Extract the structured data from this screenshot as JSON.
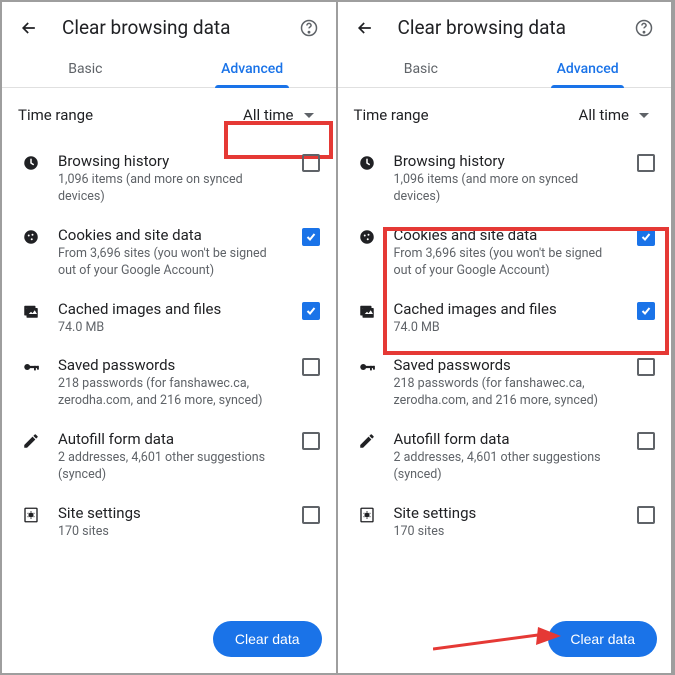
{
  "pageTitle": "Clear browsing data",
  "tabs": {
    "basic": "Basic",
    "advanced": "Advanced"
  },
  "timeRange": {
    "label": "Time range",
    "value": "All time"
  },
  "items": {
    "history": {
      "title": "Browsing history",
      "sub": "1,096 items (and more on synced devices)"
    },
    "cookies": {
      "title": "Cookies and site data",
      "sub": "From 3,696 sites (you won't be signed out of your Google Account)"
    },
    "cache": {
      "title": "Cached images and files",
      "sub": "74.0 MB"
    },
    "passwords": {
      "title": "Saved passwords",
      "sub": "218 passwords (for fanshawec.ca, zerodha.com, and 216 more, synced)"
    },
    "autofill": {
      "title": "Autofill form data",
      "sub": "2 addresses, 4,601 other suggestions (synced)"
    },
    "site": {
      "title": "Site settings",
      "sub": "170 sites"
    }
  },
  "clearButton": "Clear data"
}
